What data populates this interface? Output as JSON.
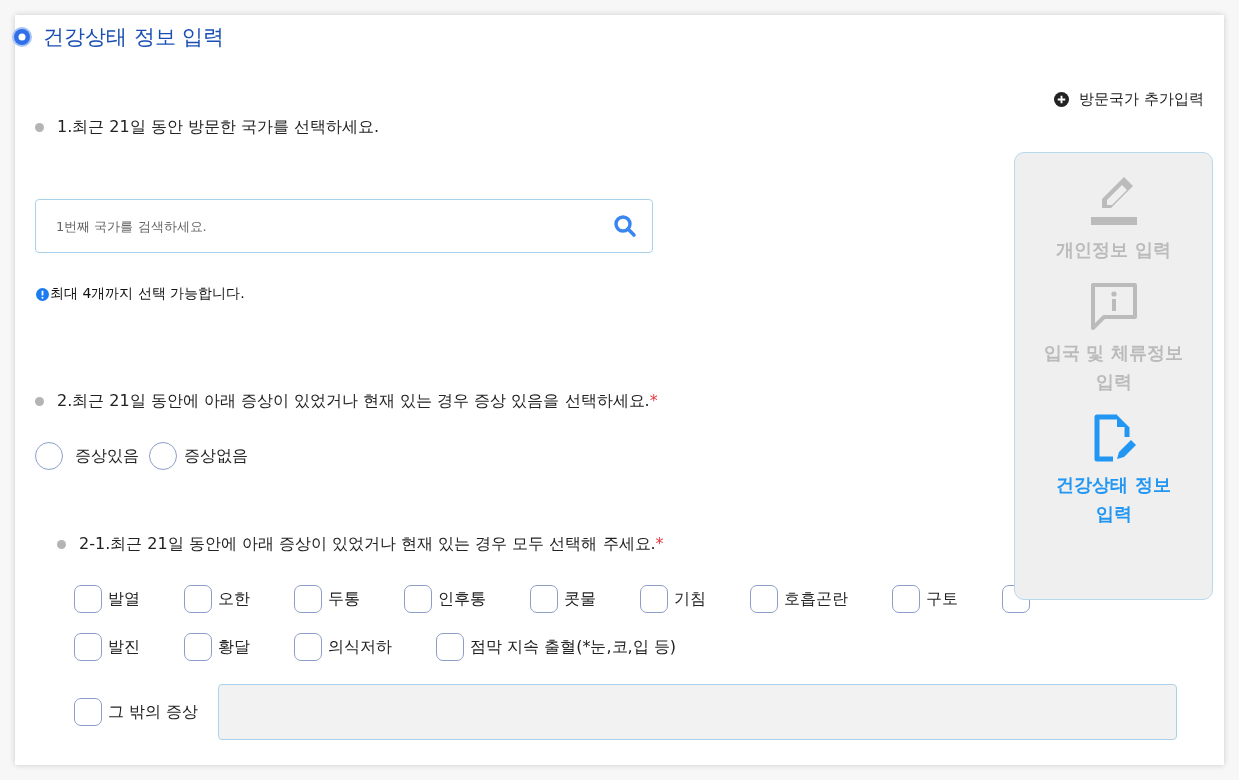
{
  "section_title": "건강상태 정보 입력",
  "add_country_link": "방문국가 추가입력",
  "question_1": {
    "text": "1.최근 21일 동안 방문한 국가를 선택하세요.",
    "search": {
      "placeholder": "1번째 국가를 검색하세요."
    },
    "note": "최대 4개까지 선택 가능합니다."
  },
  "question_2": {
    "text": "2.최근 21일 동안에 아래 증상이 있었거나 현재 있는 경우 증상 있음을 선택하세요.",
    "required_mark": "*",
    "options": [
      {
        "label": "증상있음",
        "selected": false
      },
      {
        "label": "증상없음",
        "selected": false
      }
    ]
  },
  "question_2_1": {
    "text": "2-1.최근 21일 동안에 아래 증상이 있었거나 현재 있는 경우 모두 선택해 주세요.",
    "required_mark": "*",
    "symptoms": [
      {
        "label": "발열",
        "checked": false
      },
      {
        "label": "오한",
        "checked": false
      },
      {
        "label": "두통",
        "checked": false
      },
      {
        "label": "인후통",
        "checked": false
      },
      {
        "label": "콧물",
        "checked": false
      },
      {
        "label": "기침",
        "checked": false
      },
      {
        "label": "호흡곤란",
        "checked": false
      },
      {
        "label": "구토",
        "checked": false
      },
      {
        "checked": false
      },
      {
        "label": "발진",
        "checked": false
      },
      {
        "label": "황달",
        "checked": false
      },
      {
        "label": "의식저하",
        "checked": false
      },
      {
        "label": "점막 지속 출혈(*눈,코,입 등)",
        "checked": false
      }
    ],
    "other": {
      "label": "그 밖의 증상",
      "checked": false
    }
  },
  "steps": [
    {
      "kind": "pencil",
      "label": "개인정보 입력",
      "selected": false
    },
    {
      "kind": "info",
      "label": "입국 및 체류정보 입력",
      "selected": false
    },
    {
      "kind": "document",
      "label": "건강상태 정보 입력",
      "selected": true
    }
  ]
}
